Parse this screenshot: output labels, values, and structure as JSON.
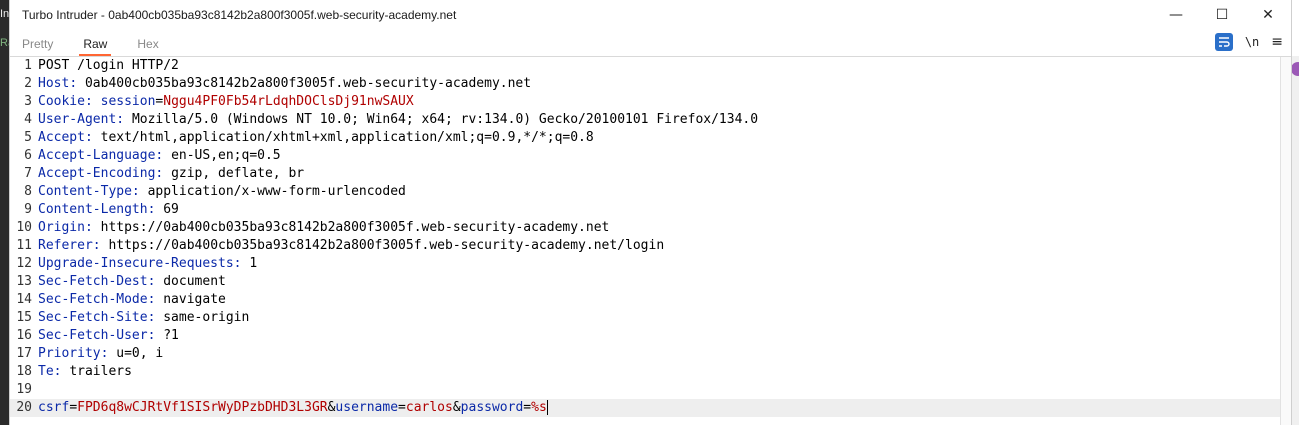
{
  "background": {
    "left_text_top": "In",
    "left_text_bottom": "Ra"
  },
  "window": {
    "title": "Turbo Intruder - 0ab400cb035ba93c8142b2a800f3005f.web-security-academy.net",
    "controls": {
      "minimize": "—",
      "maximize": "☐",
      "close": "✕"
    }
  },
  "tabs": [
    {
      "label": "Pretty",
      "active": false
    },
    {
      "label": "Raw",
      "active": true
    },
    {
      "label": "Hex",
      "active": false
    }
  ],
  "tools": {
    "newline_label": "\\n",
    "menu_glyph": "≡"
  },
  "request": {
    "request_line": "POST /login HTTP/2",
    "headers": [
      {
        "name": "Host",
        "value": "0ab400cb035ba93c8142b2a800f3005f.web-security-academy.net"
      },
      {
        "name": "Cookie",
        "value": "session=Nggu4PF0Fb54rLdqhDOClsDj91nwSAUX"
      },
      {
        "name": "User-Agent",
        "value": "Mozilla/5.0 (Windows NT 10.0; Win64; x64; rv:134.0) Gecko/20100101 Firefox/134.0"
      },
      {
        "name": "Accept",
        "value": "text/html,application/xhtml+xml,application/xml;q=0.9,*/*;q=0.8"
      },
      {
        "name": "Accept-Language",
        "value": "en-US,en;q=0.5"
      },
      {
        "name": "Accept-Encoding",
        "value": "gzip, deflate, br"
      },
      {
        "name": "Content-Type",
        "value": "application/x-www-form-urlencoded"
      },
      {
        "name": "Content-Length",
        "value": "69"
      },
      {
        "name": "Origin",
        "value": "https://0ab400cb035ba93c8142b2a800f3005f.web-security-academy.net"
      },
      {
        "name": "Referer",
        "value": "https://0ab400cb035ba93c8142b2a800f3005f.web-security-academy.net/login"
      },
      {
        "name": "Upgrade-Insecure-Requests",
        "value": "1"
      },
      {
        "name": "Sec-Fetch-Dest",
        "value": "document"
      },
      {
        "name": "Sec-Fetch-Mode",
        "value": "navigate"
      },
      {
        "name": "Sec-Fetch-Site",
        "value": "same-origin"
      },
      {
        "name": "Sec-Fetch-User",
        "value": "?1"
      },
      {
        "name": "Priority",
        "value": "u=0, i"
      },
      {
        "name": "Te",
        "value": "trailers"
      }
    ],
    "body_params": [
      {
        "name": "csrf",
        "value": "FPD6q8wCJRtVf1SISrWyDPzbDHD3L3GR"
      },
      {
        "name": "username",
        "value": "carlos"
      },
      {
        "name": "password",
        "value": "%s"
      }
    ]
  }
}
